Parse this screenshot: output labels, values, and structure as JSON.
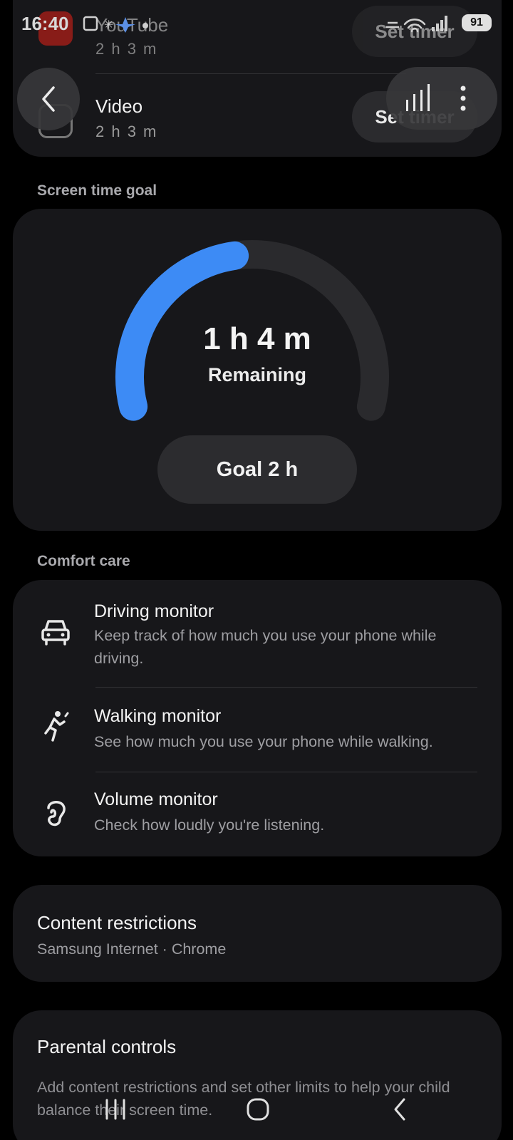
{
  "status_bar": {
    "time": "16:40",
    "battery": "91",
    "overlay_text": "YouTube"
  },
  "apps": [
    {
      "name": "YouTube",
      "time": "2 h 3 m",
      "button": "Set timer",
      "icon": "youtube-icon"
    },
    {
      "name": "Video",
      "time": "2 h 3 m",
      "button": "Set timer",
      "icon": "video-icon"
    }
  ],
  "goal": {
    "section_label": "Screen time goal",
    "remaining_time": "1 h 4 m",
    "remaining_label": "Remaining",
    "goal_button": "Goal 2 h",
    "progress_fraction": 0.46,
    "progress_color": "#3d8bf5",
    "track_color": "#2a2a2d"
  },
  "comfort": {
    "section_label": "Comfort care",
    "items": [
      {
        "title": "Driving monitor",
        "desc": "Keep track of how much you use your phone while driving.",
        "icon": "car-icon"
      },
      {
        "title": "Walking monitor",
        "desc": "See how much you use your phone while walking.",
        "icon": "walking-icon"
      },
      {
        "title": "Volume monitor",
        "desc": "Check how loudly you're listening.",
        "icon": "ear-icon"
      }
    ]
  },
  "restrictions": {
    "title": "Content restrictions",
    "sub": "Samsung Internet · Chrome"
  },
  "parental": {
    "title": "Parental controls",
    "desc": "Add content restrictions and set other limits to help your child balance their screen time."
  },
  "colors": {
    "background": "#000000",
    "card": "#17171a",
    "accent": "#3d8bf5",
    "youtube": "#e62117"
  }
}
